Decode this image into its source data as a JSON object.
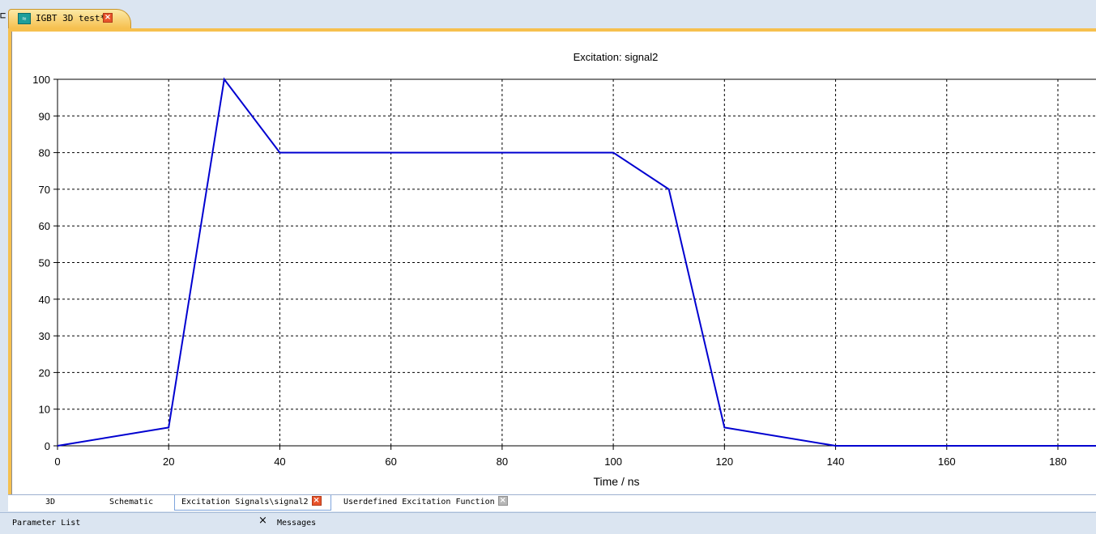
{
  "left_edge_glyph": "⊏",
  "document_tab": {
    "icon": "signal-app-icon",
    "icon_glyph": "≈",
    "title": "IGBT 3D test*",
    "close": "×"
  },
  "chart_data": {
    "type": "line",
    "title": "Excitation: signal2",
    "xlabel": "Time / ns",
    "ylabel": "",
    "xlim": [
      0,
      187
    ],
    "ylim": [
      0,
      100
    ],
    "x_ticks": [
      0,
      20,
      40,
      60,
      80,
      100,
      120,
      140,
      160,
      180
    ],
    "y_ticks": [
      0,
      10,
      20,
      30,
      40,
      50,
      60,
      70,
      80,
      90,
      100
    ],
    "grid": true,
    "series_color": "#0000d0",
    "series": [
      {
        "x": [
          0,
          20,
          30,
          40,
          100,
          110,
          120,
          140,
          187
        ],
        "y": [
          0,
          5,
          100,
          80,
          80,
          70,
          5,
          0,
          0
        ]
      }
    ]
  },
  "bottom_tabs": [
    {
      "label": "3D",
      "active": false
    },
    {
      "label": "Schematic",
      "active": false
    },
    {
      "label": "Excitation Signals\\signal2",
      "active": true,
      "close": "×"
    },
    {
      "label": "Userdefined Excitation Function",
      "active": false,
      "close": "×"
    }
  ],
  "panels": {
    "parameter_list": {
      "label": "Parameter List",
      "close": "×"
    },
    "messages": {
      "label": "Messages"
    }
  }
}
